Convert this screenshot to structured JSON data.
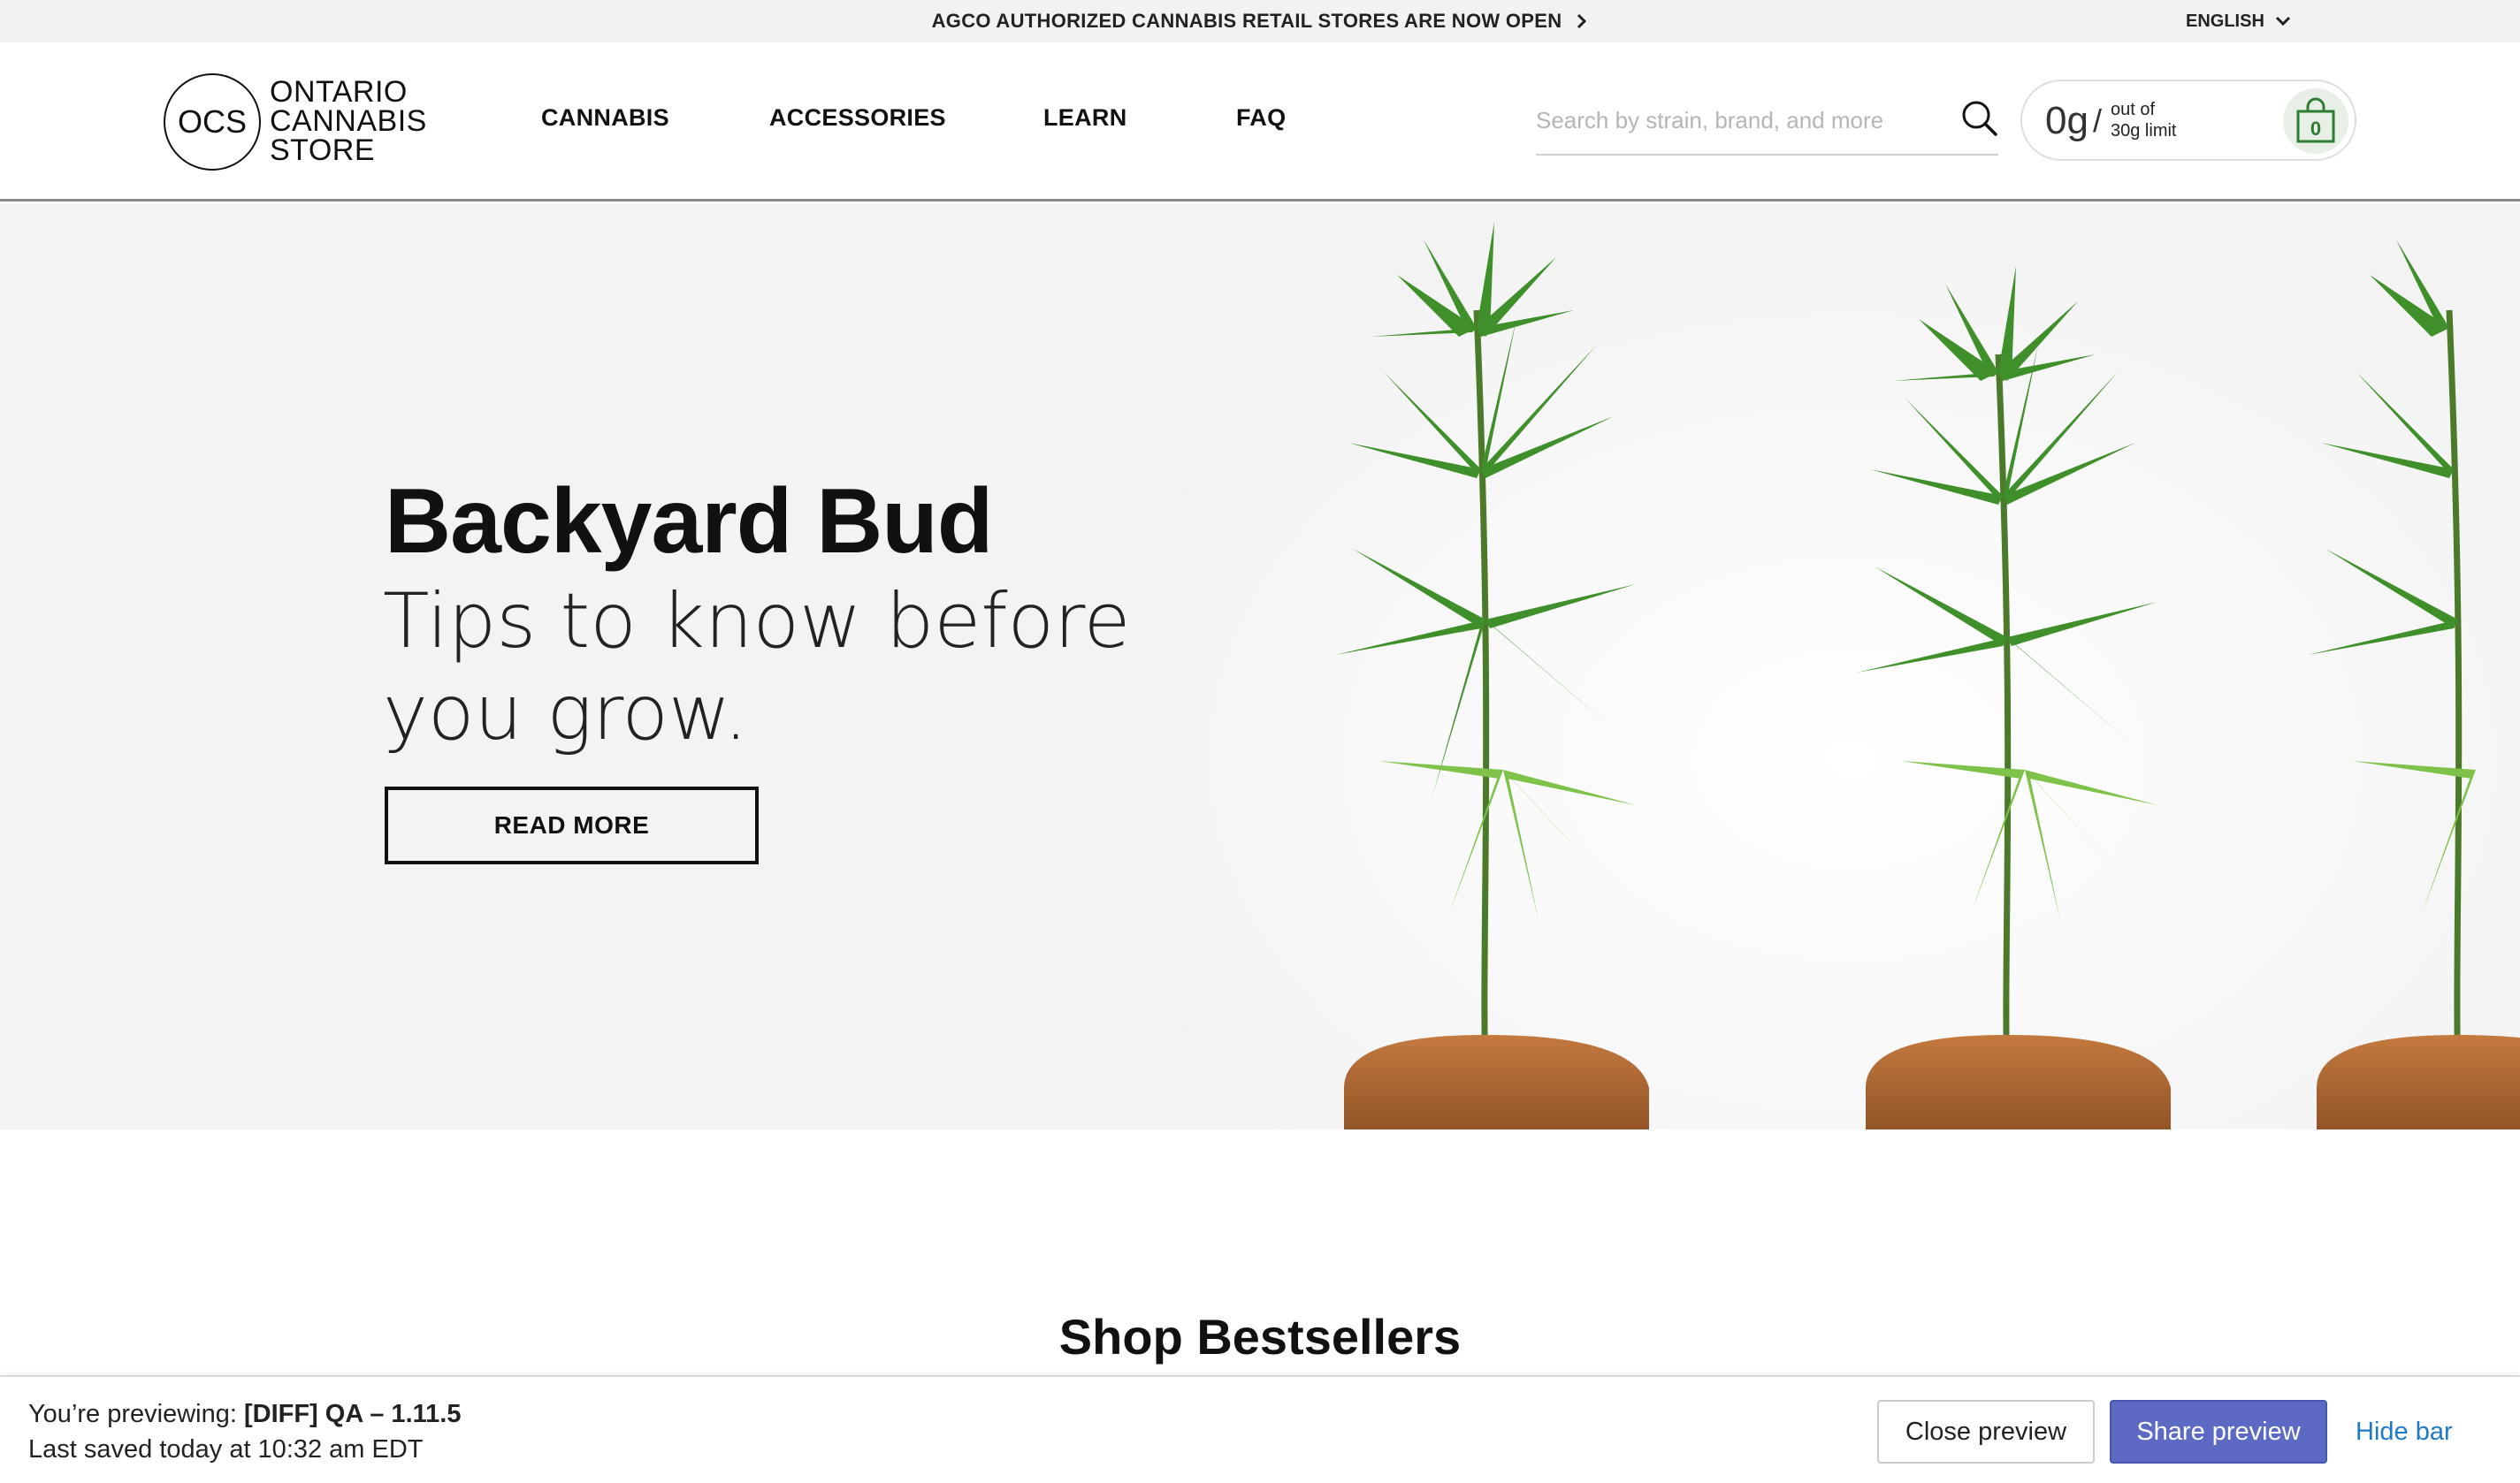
{
  "announcement": {
    "text": "AGCO AUTHORIZED CANNABIS RETAIL STORES ARE NOW OPEN",
    "arrow_icon": "chevron-right-icon",
    "language": "ENGLISH",
    "language_icon": "chevron-down-icon"
  },
  "logo": {
    "mark": "OCS",
    "line1": "ONTARIO",
    "line2": "CANNABIS",
    "line3": "STORE"
  },
  "nav": {
    "items": [
      {
        "label": "CANNABIS"
      },
      {
        "label": "ACCESSORIES"
      },
      {
        "label": "LEARN"
      },
      {
        "label": "FAQ"
      }
    ]
  },
  "search": {
    "placeholder": "Search by strain, brand, and more",
    "icon": "search-icon"
  },
  "cart": {
    "amount": "0g",
    "separator": "/",
    "limit_line1": "out of",
    "limit_line2": "30g limit",
    "count": "0",
    "icon": "shopping-bag-icon",
    "accent": "#2e7d32"
  },
  "hero": {
    "title": "Backyard Bud",
    "subtitle": "Tips to know before you grow.",
    "button_label": "READ MORE"
  },
  "section": {
    "title": "Shop Bestsellers"
  },
  "preview_bar": {
    "prefix": "You’re previewing: ",
    "theme_name": "[DIFF] QA – 1.11.5",
    "last_saved": "Last saved today at 10:32 am EDT",
    "close_label": "Close preview",
    "share_label": "Share preview",
    "hide_label": "Hide bar",
    "share_color": "#5c6ac4",
    "link_color": "#1e7ac7"
  }
}
